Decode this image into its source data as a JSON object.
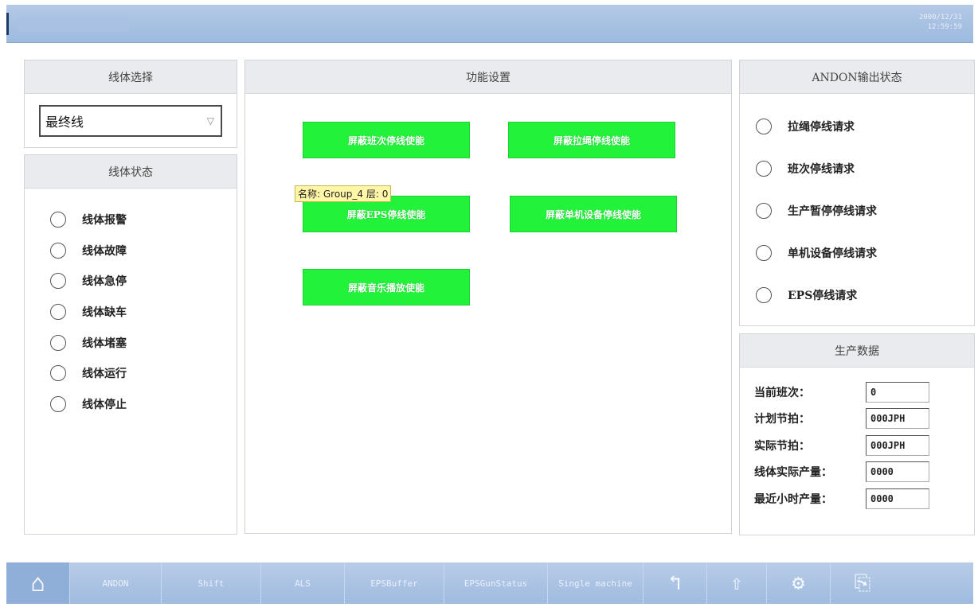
{
  "header": {
    "datetime_line1": "2000/12/31",
    "datetime_line2": "12:59:59"
  },
  "line_select": {
    "title": "线体选择",
    "selected": "最终线",
    "dropdown_icon": "triangle-down-icon"
  },
  "line_status": {
    "title": "线体状态",
    "items": [
      "线体报警",
      "线体故障",
      "线体急停",
      "线体缺车",
      "线体堵塞",
      "线体运行",
      "线体停止"
    ]
  },
  "function_settings": {
    "title": "功能设置",
    "buttons": [
      "屏蔽班次停线使能",
      "屏蔽拉绳停线使能",
      "屏蔽EPS停线使能",
      "屏蔽单机设备停线使能",
      "屏蔽音乐播放使能"
    ],
    "tooltip": "名称: Group_4   层: 0"
  },
  "andon": {
    "title": "ANDON输出状态",
    "items": [
      "拉绳停线请求",
      "班次停线请求",
      "生产暂停停线请求",
      "单机设备停线请求",
      "EPS停线请求"
    ]
  },
  "production": {
    "title": "生产数据",
    "rows": [
      {
        "label": "当前班次：",
        "value": "0"
      },
      {
        "label": "计划节拍：",
        "value": "000JPH"
      },
      {
        "label": "实际节拍：",
        "value": "000JPH"
      },
      {
        "label": "线体实际产量：",
        "value": "0000"
      },
      {
        "label": "最近小时产量：",
        "value": "0000"
      }
    ]
  },
  "nav": {
    "home_icon": "home-icon",
    "items": [
      "ANDON",
      "Shift",
      "ALS",
      "EPSBuffer",
      "EPSGunStatus",
      "Single machine"
    ],
    "back_icon": "back-arrow-icon",
    "upload_icon": "upload-icon",
    "settings_icon": "gear-icon",
    "exit_icon": "exit-icon"
  }
}
